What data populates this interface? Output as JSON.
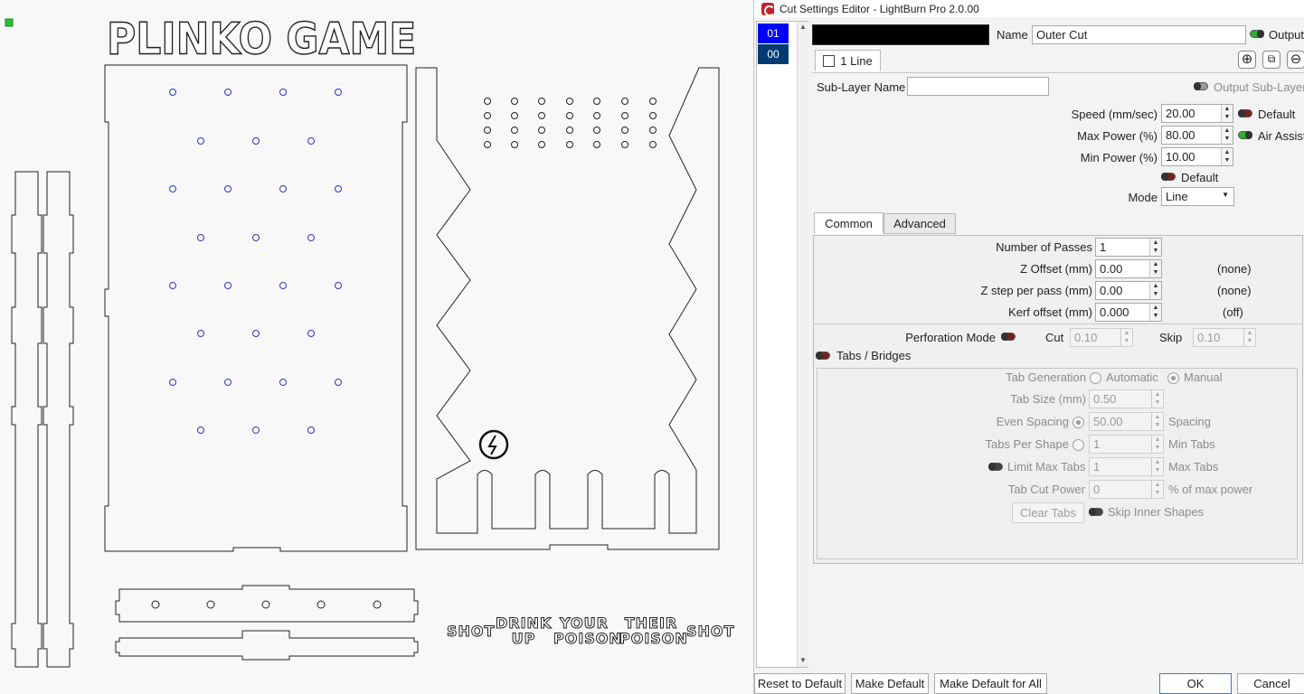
{
  "canvas": {
    "title_art": "PLINKO GAME",
    "word_art": [
      {
        "line1": "SHOT",
        "line2": ""
      },
      {
        "line1": "DRINK",
        "line2": "UP"
      },
      {
        "line1": "YOUR",
        "line2": "POISON"
      },
      {
        "line1": "THEIR",
        "line2": "POISON"
      },
      {
        "line1": "SHOT",
        "line2": ""
      }
    ]
  },
  "dialog": {
    "title": "Cut Settings Editor - LightBurn Pro 2.0.00",
    "layers": [
      {
        "label": "01",
        "color": "#0000ff"
      },
      {
        "label": "00",
        "color": "#003b73"
      }
    ],
    "layer_color": "#000000",
    "name_label": "Name",
    "name_value": "Outer Cut",
    "output_label": "Output",
    "sublayer_tab": "1 Line",
    "sublayer_name_label": "Sub-Layer Name",
    "sublayer_name_value": "",
    "output_sublayer_label": "Output Sub-Layer",
    "speed_label": "Speed (mm/sec)",
    "speed_value": "20.00",
    "speed_default_label": "Default",
    "max_power_label": "Max Power (%)",
    "max_power_value": "80.00",
    "air_assist_label": "Air Assist",
    "min_power_label": "Min Power (%)",
    "min_power_value": "10.00",
    "power_default_label": "Default",
    "mode_label": "Mode",
    "mode_value": "Line",
    "tabs": [
      "Common",
      "Advanced"
    ],
    "common": {
      "passes_label": "Number of Passes",
      "passes_value": "1",
      "z_offset_label": "Z Offset (mm)",
      "z_offset_value": "0.00",
      "z_offset_note": "(none)",
      "z_step_label": "Z step per pass (mm)",
      "z_step_value": "0.00",
      "z_step_note": "(none)",
      "kerf_label": "Kerf offset (mm)",
      "kerf_value": "0.000",
      "kerf_note": "(off)",
      "perforation_label": "Perforation Mode",
      "cut_label": "Cut",
      "cut_value": "0.10",
      "skip_label": "Skip",
      "skip_value": "0.10",
      "tabs_bridges_label": "Tabs / Bridges",
      "tab_generation_label": "Tab Generation",
      "automatic_label": "Automatic",
      "manual_label": "Manual",
      "tab_size_label": "Tab Size (mm)",
      "tab_size_value": "0.50",
      "even_spacing_label": "Even Spacing",
      "even_spacing_value": "50.00",
      "spacing_label": "Spacing",
      "tabs_per_shape_label": "Tabs Per Shape",
      "tabs_per_shape_value": "1",
      "min_tabs_label": "Min Tabs",
      "limit_max_tabs_label": "Limit Max Tabs",
      "limit_max_tabs_value": "1",
      "max_tabs_label": "Max Tabs",
      "tab_cut_power_label": "Tab Cut Power",
      "tab_cut_power_value": "0",
      "pct_max_power_label": "% of max power",
      "clear_tabs_label": "Clear Tabs",
      "skip_inner_label": "Skip Inner Shapes"
    },
    "footer": {
      "reset": "Reset to Default",
      "make_default": "Make Default",
      "make_default_all": "Make Default for All",
      "ok": "OK",
      "cancel": "Cancel"
    }
  }
}
